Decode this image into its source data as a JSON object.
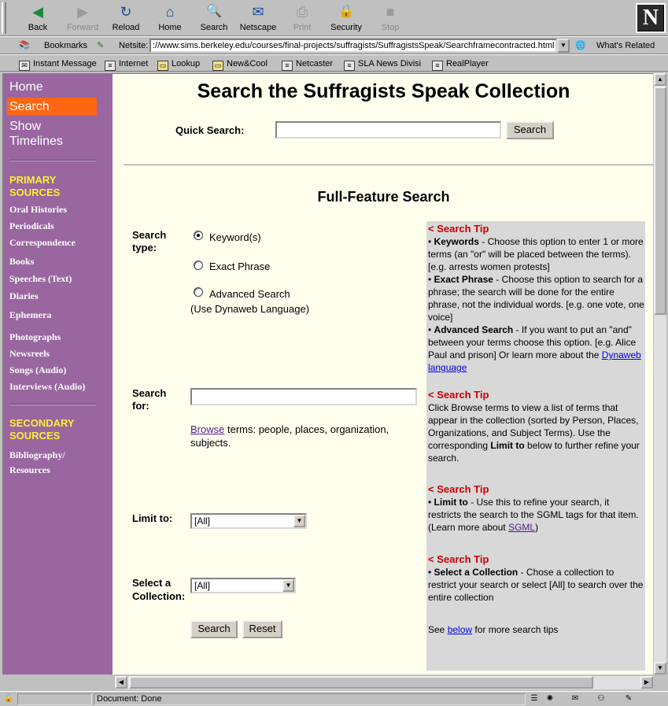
{
  "toolbar": {
    "buttons": [
      {
        "label": "Back",
        "icon": "back-arrow-icon",
        "glyph": "◀"
      },
      {
        "label": "Forward",
        "icon": "forward-arrow-icon",
        "glyph": "▶"
      },
      {
        "label": "Reload",
        "icon": "reload-icon",
        "glyph": "↻"
      },
      {
        "label": "Home",
        "icon": "home-icon",
        "glyph": "⌂"
      },
      {
        "label": "Search",
        "icon": "search-icon",
        "glyph": "🔍"
      },
      {
        "label": "Netscape",
        "icon": "netscape-icon",
        "glyph": "✉"
      },
      {
        "label": "Print",
        "icon": "print-icon",
        "glyph": "⎙"
      },
      {
        "label": "Security",
        "icon": "security-lock-icon",
        "glyph": "🔒"
      },
      {
        "label": "Stop",
        "icon": "stop-icon",
        "glyph": "■"
      }
    ],
    "logo": "N"
  },
  "location": {
    "bookmarks_label": "Bookmarks",
    "netsite_label": "Netsite:",
    "url": "://www.sims.berkeley.edu/courses/final-projects/suffragists/SuffragistsSpeak/Searchframecontracted.html",
    "whats_related": "What's Related"
  },
  "personal_toolbar": [
    "Instant Message",
    "Internet",
    "Lookup",
    "New&Cool",
    "Netcaster",
    "SLA News Divisi",
    "RealPlayer"
  ],
  "sidebar": {
    "top_links": [
      "Home",
      "Search",
      "Show",
      "Timelines"
    ],
    "primary_heading": [
      "PRIMARY",
      "SOURCES"
    ],
    "primary_links": [
      "Oral Histories",
      "Periodicals",
      "Correspondence",
      "Books",
      "Speeches (Text)",
      "Diaries",
      "Ephemera",
      "Photographs",
      "Newsreels",
      "Songs (Audio)",
      "Interviews (Audio)"
    ],
    "secondary_heading": [
      "SECONDARY",
      "SOURCES"
    ],
    "secondary_links": [
      "Bibliography/",
      "Resources"
    ]
  },
  "main": {
    "title": "Search the Suffragists Speak Collection",
    "quick_search_label": "Quick Search:",
    "quick_search_value": "",
    "search_button": "Search",
    "full_title": "Full-Feature Search",
    "search_type_label": [
      "Search",
      "type:"
    ],
    "options": [
      "Keyword(s)",
      "Exact Phrase",
      "Advanced Search"
    ],
    "dynaweb_note": "(Use Dynaweb Language)",
    "search_for_label": [
      "Search",
      "for:"
    ],
    "search_for_value": "",
    "browse_link": "Browse",
    "browse_rest": " terms: people, places, organization, subjects.",
    "limit_label": "Limit to:",
    "limit_value": "[All]",
    "collection_label": [
      "Select a",
      "Collection:"
    ],
    "collection_value": "[All]",
    "submit_button": "Search",
    "reset_button": "Reset"
  },
  "tips": {
    "heading": "< Search Tip",
    "t1": {
      "k1": "Keywords",
      "d1": " - Choose this option to enter 1 or more terms (an \"or\" will be placed between the terms). [e.g. arrests women protests]",
      "k2": "Exact Phrase",
      "d2": " - Choose this option to search for a phrase; the search will be done for the entire phrase, not the individual words. [e.g. one vote, one voice]",
      "k3": "Advanced Search",
      "d3": " - If you want to put an \"and\" between your terms choose this option. [e.g. Alice Paul and prison] Or learn more about the ",
      "link": "Dynaweb language "
    },
    "t2": {
      "pre": "Click Browse terms to view a list of terms that appear in the collection (sorted by Person, Places, Organizations, and Subject Terms). Use the corresponding ",
      "bold": "Limit to",
      "post": " below to further refine your search."
    },
    "t3": {
      "bold": "Limit to",
      "pre": " - Use this to refine your search, it restricts the search to the SGML tags for that item. (Learn more about ",
      "link": "SGML",
      "post": ")"
    },
    "t4": {
      "bold": "Select a Collection",
      "post": " - Chose a collection to restrict your search or select [All] to search over the entire collection"
    },
    "see_pre": "See ",
    "see_link": "below",
    "see_post": " for more search tips"
  },
  "status": {
    "text": "Document: Done"
  }
}
